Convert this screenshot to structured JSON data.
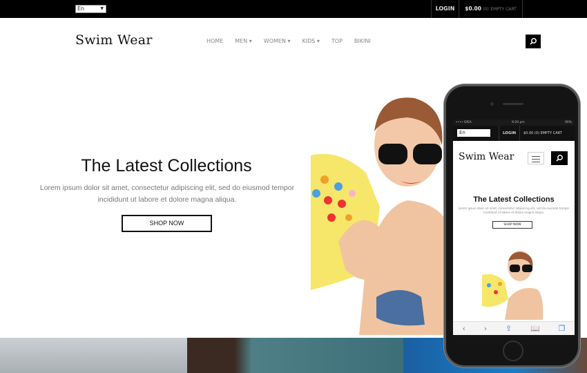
{
  "topbar": {
    "language": "En",
    "login": "LOGIN",
    "cart_amount": "$0.00",
    "cart_count": "(0)",
    "cart_label": "EMPTY CART"
  },
  "header": {
    "logo": "Swim Wear",
    "nav": [
      {
        "label": "HOME",
        "dropdown": false
      },
      {
        "label": "MEN ▾",
        "dropdown": true
      },
      {
        "label": "WOMEN ▾",
        "dropdown": true
      },
      {
        "label": "KIDS ▾",
        "dropdown": true
      },
      {
        "label": "TOP",
        "dropdown": false
      },
      {
        "label": "BIKINI",
        "dropdown": false
      }
    ],
    "search_icon": "search-icon"
  },
  "hero": {
    "title": "The Latest Collections",
    "text": "Lorem ipsum dolor sit amet, consectetur adipiscing elit, sed do eiusmod tempor incididunt ut labore et dolore magna aliqua.",
    "button": "SHOP NOW"
  },
  "phone": {
    "carrier": "•••• IDEA",
    "time": "9:20 pm",
    "battery": "90%",
    "language": "En",
    "login": "LOGIN",
    "cart": "$0.00 (0) EMPTY CART",
    "logo": "Swim Wear",
    "title": "The Latest Collections",
    "text": "Lorem ipsum dolor sit amet, consectetur adipiscing elit, sed do eiusmod tempor incididunt ut labore et dolore magna aliqua.",
    "button": "SHOP NOW",
    "toolbar": {
      "back": "‹",
      "forward": "›",
      "share": "⇪",
      "bookmarks": "📖",
      "tabs": "❐"
    }
  }
}
